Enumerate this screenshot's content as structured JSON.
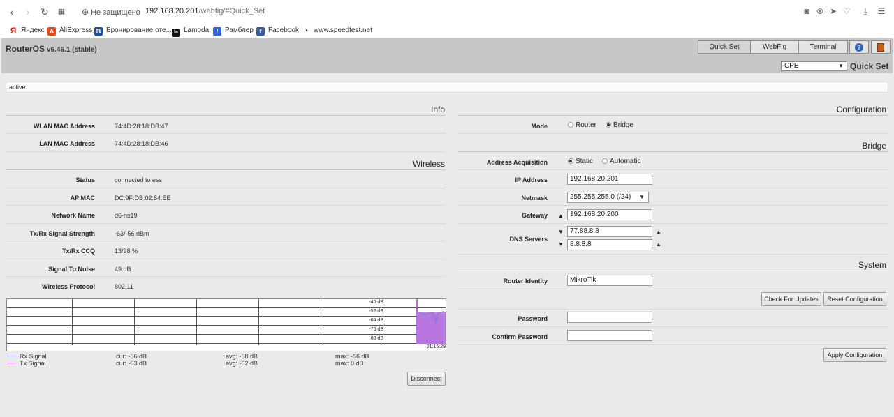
{
  "browser": {
    "insecure_label": "Не защищено",
    "url_host": "192.168.20.201",
    "url_path": "/webfig/#Quick_Set",
    "bookmarks": [
      {
        "label": "Яндекс",
        "icon": "yandex-icon",
        "color": "#e0261d",
        "glyph": "Я"
      },
      {
        "label": "AliExpress",
        "icon": "aliexpress-icon",
        "color": "#e8471e",
        "glyph": "A"
      },
      {
        "label": "Бронирование оте...",
        "icon": "booking-icon",
        "color": "#1e4f9d",
        "glyph": "B"
      },
      {
        "label": "Lamoda",
        "icon": "lamoda-icon",
        "color": "#111111",
        "glyph": "la"
      },
      {
        "label": "Рамблер",
        "icon": "rambler-icon",
        "color": "#2f64d6",
        "glyph": "/"
      },
      {
        "label": "Facebook",
        "icon": "facebook-icon",
        "color": "#3b5a9a",
        "glyph": "f"
      },
      {
        "label": "www.speedtest.net",
        "icon": "speedtest-icon",
        "color": "#ffffff",
        "glyph": "◔"
      }
    ]
  },
  "header": {
    "title": "RouterOS",
    "version": "v6.46.1 (stable)",
    "tabs": [
      "Quick Set",
      "WebFig",
      "Terminal"
    ],
    "mode_value": "CPE",
    "quickset_label": "Quick Set"
  },
  "status": "active",
  "info": {
    "title": "Info",
    "rows": [
      {
        "label": "WLAN MAC Address",
        "value": "74:4D:28:18:DB:47"
      },
      {
        "label": "LAN MAC Address",
        "value": "74:4D:28:18:DB:46"
      }
    ]
  },
  "wireless": {
    "title": "Wireless",
    "rows": [
      {
        "label": "Status",
        "value": "connected to ess"
      },
      {
        "label": "AP MAC",
        "value": "DC:9F:DB:02:84:EE"
      },
      {
        "label": "Network Name",
        "value": "d6-ns19"
      },
      {
        "label": "Tx/Rx Signal Strength",
        "value": "-63/-56 dBm"
      },
      {
        "label": "Tx/Rx CCQ",
        "value": "13/98 %"
      },
      {
        "label": "Signal To Noise",
        "value": "49 dB"
      },
      {
        "label": "Wireless Protocol",
        "value": "802.11"
      }
    ]
  },
  "graph": {
    "y_labels": [
      "-40 dB",
      "-52 dB",
      "-64 dB",
      "-76 dB",
      "-88 dB"
    ],
    "time_label": "21:15:29",
    "legend": [
      {
        "name": "Rx Signal",
        "cur": "cur: -56 dB",
        "avg": "avg: -58 dB",
        "max": "max: -56 dB",
        "color": "#6b6bd6"
      },
      {
        "name": "Tx Signal",
        "cur": "cur: -63 dB",
        "avg": "avg: -62 dB",
        "max": "max: 0 dB",
        "color": "#d65cd6"
      }
    ],
    "disconnect_label": "Disconnect"
  },
  "configuration": {
    "title": "Configuration",
    "mode_label": "Mode",
    "mode_options": [
      "Router",
      "Bridge"
    ],
    "mode_selected": "Bridge"
  },
  "bridge": {
    "title": "Bridge",
    "acq_label": "Address Acquisition",
    "acq_options": [
      "Static",
      "Automatic"
    ],
    "acq_selected": "Static",
    "ip_label": "IP Address",
    "ip_value": "192.168.20.201",
    "netmask_label": "Netmask",
    "netmask_value": "255.255.255.0 (/24)",
    "gateway_label": "Gateway",
    "gateway_value": "192.168.20.200",
    "dns_label": "DNS Servers",
    "dns_values": [
      "77.88.8.8",
      "8.8.8.8"
    ]
  },
  "system": {
    "title": "System",
    "identity_label": "Router Identity",
    "identity_value": "MikroTik",
    "check_updates_label": "Check For Updates",
    "reset_label": "Reset Configuration",
    "password_label": "Password",
    "confirm_label": "Confirm Password",
    "apply_label": "Apply Configuration"
  }
}
